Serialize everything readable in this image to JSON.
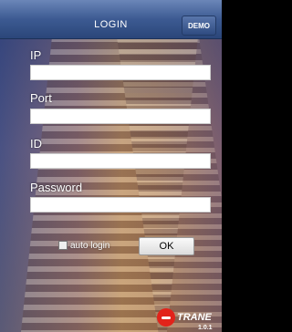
{
  "navbar": {
    "title": "LOGIN",
    "demo_label": "DEMO"
  },
  "form": {
    "ip_label": "IP",
    "ip_value": "",
    "port_label": "Port",
    "port_value": "",
    "id_label": "ID",
    "id_value": "",
    "password_label": "Password",
    "password_value": "",
    "auto_login_label": "auto login",
    "auto_login_checked": false,
    "ok_label": "OK"
  },
  "branding": {
    "logo_text": "TRANE",
    "logo_color": "#e2231a",
    "version": "1.0.1"
  }
}
